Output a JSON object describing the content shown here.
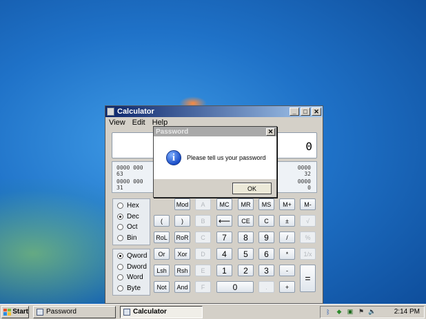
{
  "calculator": {
    "title": "Calculator",
    "menu": [
      "View",
      "Edit",
      "Help"
    ],
    "display_value": "0",
    "bits": {
      "left_row1": "0000  000",
      "left_idx1": "63",
      "left_row2": "0000  000",
      "left_idx2": "31",
      "right_row1": "0000",
      "right_idx1": "32",
      "right_row2": "0000",
      "right_idx2": "0"
    },
    "base_radios": [
      {
        "label": "Hex",
        "selected": false
      },
      {
        "label": "Dec",
        "selected": true
      },
      {
        "label": "Oct",
        "selected": false
      },
      {
        "label": "Bin",
        "selected": false
      }
    ],
    "word_radios": [
      {
        "label": "Qword",
        "selected": true
      },
      {
        "label": "Dword",
        "selected": false
      },
      {
        "label": "Word",
        "selected": false
      },
      {
        "label": "Byte",
        "selected": false
      }
    ],
    "keys": {
      "mod": "Mod",
      "a": "A",
      "mc": "MC",
      "mr": "MR",
      "ms": "MS",
      "mplus": "M+",
      "mminus": "M-",
      "lparen": "(",
      "rparen": ")",
      "b": "B",
      "back": "⟵",
      "ce": "CE",
      "c": "C",
      "plusminus": "±",
      "sqrt": "√",
      "rol": "RoL",
      "ror": "RoR",
      "cc": "C",
      "n7": "7",
      "n8": "8",
      "n9": "9",
      "div": "/",
      "pct": "%",
      "or": "Or",
      "xor": "Xor",
      "d": "D",
      "n4": "4",
      "n5": "5",
      "n6": "6",
      "mul": "*",
      "recip": "1/x",
      "lsh": "Lsh",
      "rsh": "Rsh",
      "e": "E",
      "n1": "1",
      "n2": "2",
      "n3": "3",
      "sub": "-",
      "eq": "=",
      "not": "Not",
      "and": "And",
      "f": "F",
      "n0": "0",
      "dot": ".",
      "add": "+"
    }
  },
  "dialog": {
    "title": "Password",
    "message": "Please tell us your password",
    "ok_label": "OK"
  },
  "taskbar": {
    "start_label": "Start",
    "buttons": [
      {
        "label": "Password"
      },
      {
        "label": "Calculator"
      }
    ],
    "clock": "2:14 PM"
  }
}
